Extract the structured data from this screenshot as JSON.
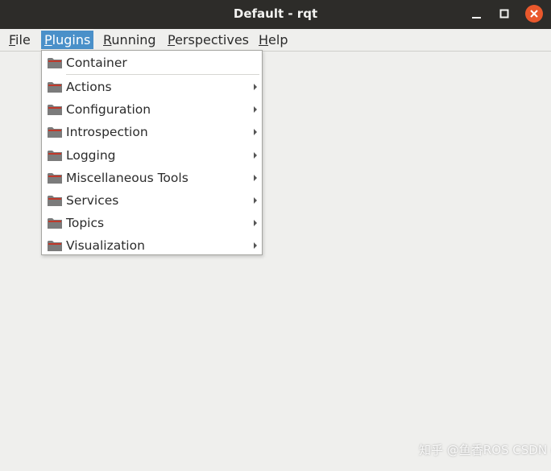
{
  "window": {
    "title": "Default - rqt",
    "controls": {
      "minimize": "minimize-icon",
      "maximize": "maximize-icon",
      "close": "close-icon"
    },
    "close_color": "#e9582c"
  },
  "menubar": {
    "items": [
      {
        "mnemonic": "F",
        "rest": "ile"
      },
      {
        "mnemonic": "P",
        "rest": "lugins"
      },
      {
        "mnemonic": "R",
        "rest": "unning"
      },
      {
        "mnemonic": "P",
        "rest": "erspectives"
      },
      {
        "mnemonic": "H",
        "rest": "elp"
      }
    ],
    "active_color": "#4a90c9"
  },
  "plugins_menu": {
    "items": [
      {
        "label": "Container",
        "icon": "folder-icon",
        "submenu": false
      },
      {
        "label": "Actions",
        "icon": "folder-icon",
        "submenu": true
      },
      {
        "label": "Configuration",
        "icon": "folder-icon",
        "submenu": true
      },
      {
        "label": "Introspection",
        "icon": "folder-icon",
        "submenu": true
      },
      {
        "label": "Logging",
        "icon": "folder-icon",
        "submenu": true
      },
      {
        "label": "Miscellaneous Tools",
        "icon": "folder-icon",
        "submenu": true
      },
      {
        "label": "Services",
        "icon": "folder-icon",
        "submenu": true
      },
      {
        "label": "Topics",
        "icon": "folder-icon",
        "submenu": true
      },
      {
        "label": "Visualization",
        "icon": "folder-icon",
        "submenu": true
      }
    ],
    "folder_color": "#7b7b7b",
    "folder_accent": "#c0392b"
  },
  "watermark": {
    "text": "知乎 @鱼香ROS CSDN @鱼香ROS"
  }
}
